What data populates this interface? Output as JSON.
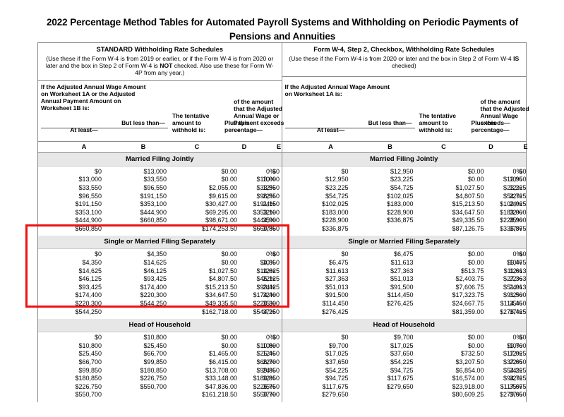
{
  "document": {
    "title": "2022 Percentage Method Tables for Automated Payroll Systems and Withholding on Periodic Payments of Pensions and Annuities"
  },
  "schedules": [
    {
      "id": "standard",
      "title": "STANDARD Withholding Rate Schedules",
      "note_part1": "(Use these if the Form W-4 is from 2019 or earlier, or if the Form W-4 is from 2020 or later and the box in Step 2 of Form W-4 is ",
      "note_emphasis": "NOT",
      "note_part2": " checked. Also use these for Form W-4P from any year.)",
      "lead_in": "If the Adjusted Annual Wage Amount on Worksheet 1A or the Adjusted Annual Payment Amount on Worksheet 1B is:",
      "columns": {
        "a": "At least—",
        "b": "But less than—",
        "c": "The tentative amount to withhold is:",
        "d": "Plus this percentage—",
        "e": "of the amount that the Adjusted Annual Wage or Payment exceeds—"
      },
      "letters": [
        "A",
        "B",
        "C",
        "D",
        "E"
      ],
      "sections": [
        {
          "status": "Married Filing Jointly",
          "rows": [
            {
              "a": "$0",
              "b": "$13,000",
              "c": "$0.00",
              "d": "0%",
              "e": "$0"
            },
            {
              "a": "$13,000",
              "b": "$33,550",
              "c": "$0.00",
              "d": "10%",
              "e": "$13,000"
            },
            {
              "a": "$33,550",
              "b": "$96,550",
              "c": "$2,055.00",
              "d": "12%",
              "e": "$33,550"
            },
            {
              "a": "$96,550",
              "b": "$191,150",
              "c": "$9,615.00",
              "d": "22%",
              "e": "$96,550"
            },
            {
              "a": "$191,150",
              "b": "$353,100",
              "c": "$30,427.00",
              "d": "24%",
              "e": "$191,150"
            },
            {
              "a": "$353,100",
              "b": "$444,900",
              "c": "$69,295.00",
              "d": "32%",
              "e": "$353,100"
            },
            {
              "a": "$444,900",
              "b": "$660,850",
              "c": "$98,671.00",
              "d": "35%",
              "e": "$444,900"
            },
            {
              "a": "$660,850",
              "b": "",
              "c": "$174,253.50",
              "d": "37%",
              "e": "$660,850"
            }
          ]
        },
        {
          "status": "Single or Married Filing Separately",
          "rows": [
            {
              "a": "$0",
              "b": "$4,350",
              "c": "$0.00",
              "d": "0%",
              "e": "$0"
            },
            {
              "a": "$4,350",
              "b": "$14,625",
              "c": "$0.00",
              "d": "10%",
              "e": "$4,350"
            },
            {
              "a": "$14,625",
              "b": "$46,125",
              "c": "$1,027.50",
              "d": "12%",
              "e": "$14,625"
            },
            {
              "a": "$46,125",
              "b": "$93,425",
              "c": "$4,807.50",
              "d": "22%",
              "e": "$46,125"
            },
            {
              "a": "$93,425",
              "b": "$174,400",
              "c": "$15,213.50",
              "d": "24%",
              "e": "$93,425"
            },
            {
              "a": "$174,400",
              "b": "$220,300",
              "c": "$34,647.50",
              "d": "32%",
              "e": "$174,400"
            },
            {
              "a": "$220,300",
              "b": "$544,250",
              "c": "$49,335.50",
              "d": "35%",
              "e": "$220,300"
            },
            {
              "a": "$544,250",
              "b": "",
              "c": "$162,718.00",
              "d": "37%",
              "e": "$544,250"
            }
          ]
        },
        {
          "status": "Head of Household",
          "rows": [
            {
              "a": "$0",
              "b": "$10,800",
              "c": "$0.00",
              "d": "0%",
              "e": "$0"
            },
            {
              "a": "$10,800",
              "b": "$25,450",
              "c": "$0.00",
              "d": "10%",
              "e": "$10,800"
            },
            {
              "a": "$25,450",
              "b": "$66,700",
              "c": "$1,465.00",
              "d": "12%",
              "e": "$25,450"
            },
            {
              "a": "$66,700",
              "b": "$99,850",
              "c": "$6,415.00",
              "d": "22%",
              "e": "$66,700"
            },
            {
              "a": "$99,850",
              "b": "$180,850",
              "c": "$13,708.00",
              "d": "24%",
              "e": "$99,850"
            },
            {
              "a": "$180,850",
              "b": "$226,750",
              "c": "$33,148.00",
              "d": "32%",
              "e": "$180,850"
            },
            {
              "a": "$226,750",
              "b": "$550,700",
              "c": "$47,836.00",
              "d": "35%",
              "e": "$226,750"
            },
            {
              "a": "$550,700",
              "b": "",
              "c": "$161,218.50",
              "d": "37%",
              "e": "$550,700"
            }
          ]
        }
      ]
    },
    {
      "id": "step2-checkbox",
      "title": "Form W-4, Step 2, Checkbox, Withholding Rate Schedules",
      "note_part1": "(Use these if the Form W-4 is from 2020 or later and the box in Step 2 of Form W-4 ",
      "note_emphasis": "IS",
      "note_part2": " checked)",
      "lead_in": "If the Adjusted Annual Wage Amount on Worksheet 1A is:",
      "columns": {
        "a": "At least—",
        "b": "But less than—",
        "c": "The tentative amount to withhold is:",
        "d": "Plus this percentage—",
        "e": "of the amount that the Adjusted Annual Wage exceeds—"
      },
      "letters": [
        "A",
        "B",
        "C",
        "D",
        "E"
      ],
      "sections": [
        {
          "status": "Married Filing Jointly",
          "rows": [
            {
              "a": "$0",
              "b": "$12,950",
              "c": "$0.00",
              "d": "0%",
              "e": "$0"
            },
            {
              "a": "$12,950",
              "b": "$23,225",
              "c": "$0.00",
              "d": "10%",
              "e": "$12,950"
            },
            {
              "a": "$23,225",
              "b": "$54,725",
              "c": "$1,027.50",
              "d": "12%",
              "e": "$23,225"
            },
            {
              "a": "$54,725",
              "b": "$102,025",
              "c": "$4,807.50",
              "d": "22%",
              "e": "$54,725"
            },
            {
              "a": "$102,025",
              "b": "$183,000",
              "c": "$15,213.50",
              "d": "24%",
              "e": "$102,025"
            },
            {
              "a": "$183,000",
              "b": "$228,900",
              "c": "$34,647.50",
              "d": "32%",
              "e": "$183,000"
            },
            {
              "a": "$228,900",
              "b": "$336,875",
              "c": "$49,335.50",
              "d": "35%",
              "e": "$228,900"
            },
            {
              "a": "$336,875",
              "b": "",
              "c": "$87,126.75",
              "d": "37%",
              "e": "$336,875"
            }
          ]
        },
        {
          "status": "Single or Married Filing Separately",
          "rows": [
            {
              "a": "$0",
              "b": "$6,475",
              "c": "$0.00",
              "d": "0%",
              "e": "$0"
            },
            {
              "a": "$6,475",
              "b": "$11,613",
              "c": "$0.00",
              "d": "10%",
              "e": "$6,475"
            },
            {
              "a": "$11,613",
              "b": "$27,363",
              "c": "$513.75",
              "d": "12%",
              "e": "$11,613"
            },
            {
              "a": "$27,363",
              "b": "$51,013",
              "c": "$2,403.75",
              "d": "22%",
              "e": "$27,363"
            },
            {
              "a": "$51,013",
              "b": "$91,500",
              "c": "$7,606.75",
              "d": "24%",
              "e": "$51,013"
            },
            {
              "a": "$91,500",
              "b": "$114,450",
              "c": "$17,323.75",
              "d": "32%",
              "e": "$91,500"
            },
            {
              "a": "$114,450",
              "b": "$276,425",
              "c": "$24,667.75",
              "d": "35%",
              "e": "$114,450"
            },
            {
              "a": "$276,425",
              "b": "",
              "c": "$81,359.00",
              "d": "37%",
              "e": "$276,425"
            }
          ]
        },
        {
          "status": "Head of Household",
          "rows": [
            {
              "a": "$0",
              "b": "$9,700",
              "c": "$0.00",
              "d": "0%",
              "e": "$0"
            },
            {
              "a": "$9,700",
              "b": "$17,025",
              "c": "$0.00",
              "d": "10%",
              "e": "$9,700"
            },
            {
              "a": "$17,025",
              "b": "$37,650",
              "c": "$732.50",
              "d": "12%",
              "e": "$17,025"
            },
            {
              "a": "$37,650",
              "b": "$54,225",
              "c": "$3,207.50",
              "d": "22%",
              "e": "$37,650"
            },
            {
              "a": "$54,225",
              "b": "$94,725",
              "c": "$6,854.00",
              "d": "24%",
              "e": "$54,225"
            },
            {
              "a": "$94,725",
              "b": "$117,675",
              "c": "$16,574.00",
              "d": "32%",
              "e": "$94,725"
            },
            {
              "a": "$117,675",
              "b": "$279,650",
              "c": "$23,918.00",
              "d": "35%",
              "e": "$117,675"
            },
            {
              "a": "$279,650",
              "b": "",
              "c": "$80,609.25",
              "d": "37%",
              "e": "$279,650"
            }
          ]
        }
      ]
    }
  ],
  "annotation": {
    "highlight_color": "#ee1111",
    "target_section": "Single or Married Filing Separately"
  }
}
